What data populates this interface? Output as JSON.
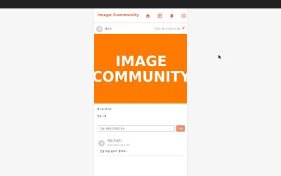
{
  "header": {
    "brand": "Image Community",
    "nav": [
      {
        "name": "home-icon"
      },
      {
        "name": "new-post-icon"
      },
      {
        "name": "bell-icon"
      },
      {
        "name": "menu-icon"
      }
    ]
  },
  "post": {
    "author": "테스트",
    "date": "2022-08-10 00:01:38",
    "image_lines": [
      "IMAGE",
      "COMMUNITY"
    ],
    "title": "테스트 포스트",
    "subtitle": "댓글 1개"
  },
  "comment_form": {
    "placeholder": "댓글 내용을 입력해주세요.",
    "submit_label": "작성"
  },
  "comments": [
    {
      "author": "커뮤니티유저",
      "date": "2022-08-10 02:14:05",
      "text": "안녕 오늘 날씨가 좋아요!"
    }
  ],
  "colors": {
    "accent": "#f0683a",
    "hero": "#ff7a00"
  }
}
